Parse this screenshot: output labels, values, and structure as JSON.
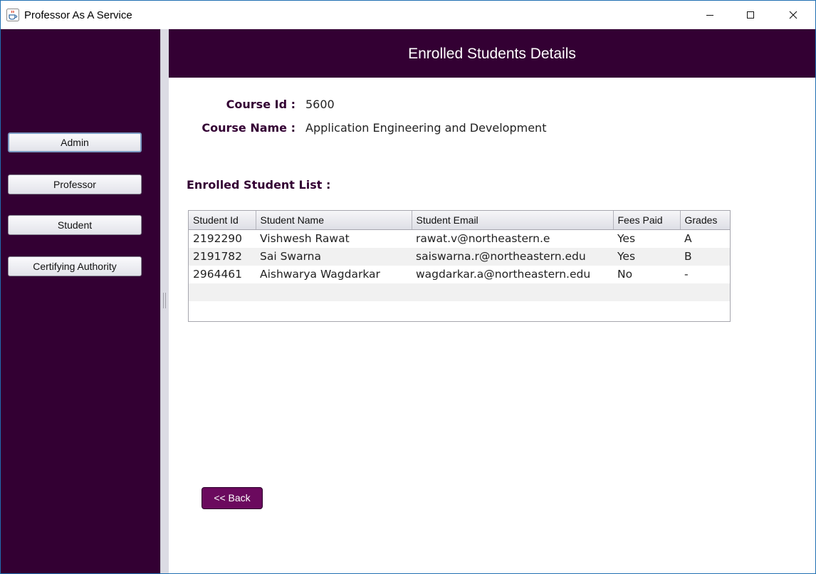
{
  "window": {
    "title": "Professor As A Service",
    "icons": {
      "app": "java-cup-icon",
      "minimize": "minimize-icon",
      "maximize": "maximize-icon",
      "close": "close-icon"
    }
  },
  "sidebar": {
    "items": [
      {
        "label": "Admin",
        "focused": true
      },
      {
        "label": "Professor"
      },
      {
        "label": "Student"
      },
      {
        "label": "Certifying Authority"
      }
    ]
  },
  "header": {
    "title": "Enrolled Students Details"
  },
  "course": {
    "id_label": "Course Id :",
    "id_value": "5600",
    "name_label": "Course Name :",
    "name_value": "Application Engineering and Development"
  },
  "list": {
    "heading": "Enrolled Student List :",
    "columns": [
      "Student Id",
      "Student Name",
      "Student Email",
      "Fees Paid",
      "Grades"
    ],
    "rows": [
      [
        "2192290",
        "Vishwesh Rawat",
        "rawat.v@northeastern.e",
        "Yes",
        "A"
      ],
      [
        "2191782",
        "Sai Swarna",
        "saiswarna.r@northeastern.edu",
        "Yes",
        "B"
      ],
      [
        "2964461",
        "Aishwarya Wagdarkar",
        "wagdarkar.a@northeastern.edu",
        "No",
        " -"
      ],
      [
        "",
        "",
        "",
        "",
        ""
      ],
      [
        "",
        "",
        "",
        "",
        ""
      ]
    ]
  },
  "actions": {
    "back_label": "<< Back"
  },
  "colors": {
    "brand_dark": "#330033",
    "back_button": "#6b0a5e",
    "window_border": "#1f6fb2"
  }
}
